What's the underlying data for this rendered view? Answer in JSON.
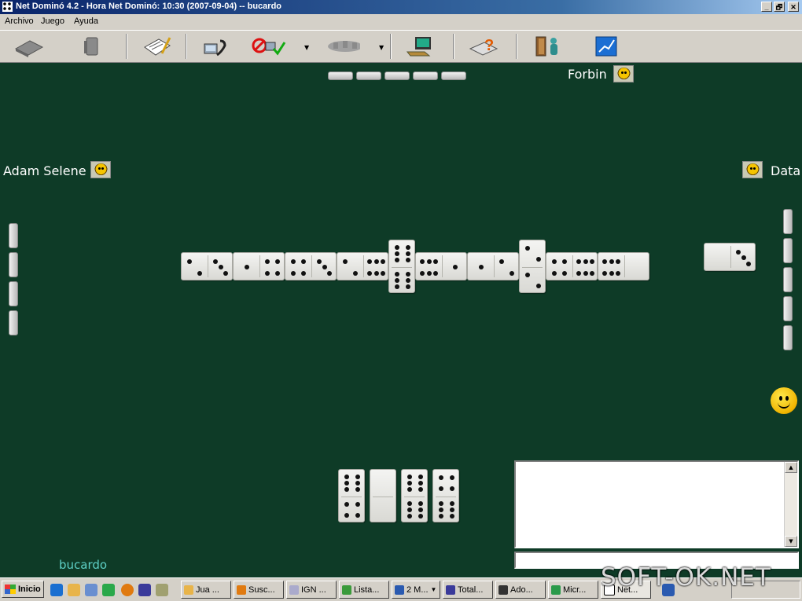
{
  "window": {
    "title": "Net Dominó 4.2  -  Hora Net Dominó: 10:30 (2007-09-04)  --  bucardo",
    "controls": [
      "_",
      "🗗",
      "✕"
    ]
  },
  "menu": [
    "Archivo",
    "Juego",
    "Ayuda"
  ],
  "toolbar": {
    "icons": [
      "table-icon",
      "stack-icon",
      "notepad-icon",
      "connect-phone-icon",
      "disconnect-icon",
      "network-icon",
      "computer-icon",
      "help-icon",
      "exit-door-icon",
      "stats-icon"
    ]
  },
  "players": {
    "north": "Forbin",
    "west": "Adam Selene",
    "east": "Data",
    "south": "bucardo"
  },
  "hand_counts": {
    "north": 5,
    "west": 4,
    "east": 5
  },
  "board": [
    [
      2,
      3
    ],
    [
      1,
      4
    ],
    [
      4,
      3
    ],
    [
      2,
      6
    ],
    [
      6,
      6
    ],
    [
      6,
      1
    ],
    [
      1,
      2
    ],
    [
      2,
      2
    ],
    [
      4,
      6
    ],
    [
      6,
      0
    ]
  ],
  "east_last_played": [
    0,
    3
  ],
  "my_hand": [
    [
      6,
      4
    ],
    [
      0,
      0
    ],
    [
      6,
      6
    ],
    [
      4,
      6
    ]
  ],
  "taskbar": {
    "start": "Inicio",
    "tasks": [
      "Jua ...",
      "Susc...",
      "IGN ...",
      "Lista...",
      "2 M...",
      "Total...",
      "Ado...",
      "Micr...",
      "Net..."
    ]
  },
  "watermark": "SOFT-OK.NET",
  "colors": {
    "felt": "#0e3b27",
    "my_name": "#5ed0c6",
    "player_name": "#ffffff"
  }
}
